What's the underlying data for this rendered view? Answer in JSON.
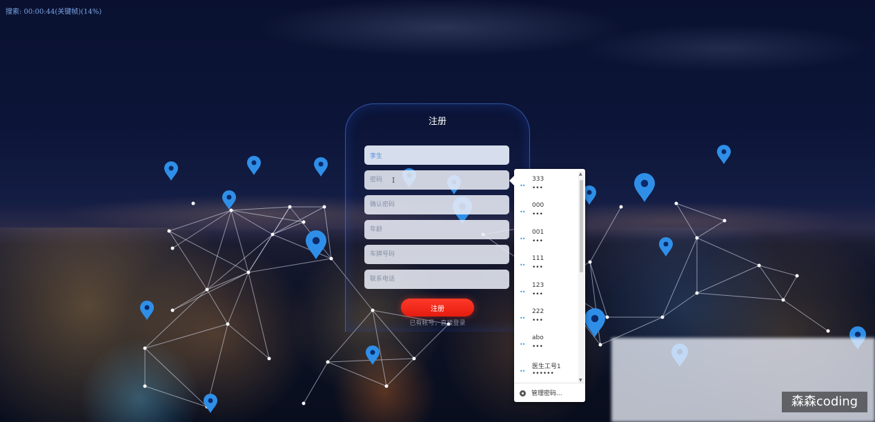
{
  "status_text": "搜索: 00:00:44(关键帧)(14%)",
  "register": {
    "title": "注册",
    "fields": [
      {
        "name": "username-field",
        "value": "李生",
        "placeholder": ""
      },
      {
        "name": "password-field",
        "value": "",
        "placeholder": "密码"
      },
      {
        "name": "confirm-password-field",
        "value": "",
        "placeholder": "确认密码"
      },
      {
        "name": "age-field",
        "value": "",
        "placeholder": "年龄"
      },
      {
        "name": "plate-number-field",
        "value": "",
        "placeholder": "车牌号码"
      },
      {
        "name": "phone-field",
        "value": "",
        "placeholder": "联系电话"
      }
    ],
    "submit_label": "注册",
    "login_prompt": "已有帐号，直接登录"
  },
  "password_dropdown": {
    "items": [
      {
        "user": "333",
        "pass": "•••"
      },
      {
        "user": "000",
        "pass": "•••"
      },
      {
        "user": "001",
        "pass": "•••"
      },
      {
        "user": "111",
        "pass": "•••"
      },
      {
        "user": "123",
        "pass": "•••"
      },
      {
        "user": "222",
        "pass": "•••"
      },
      {
        "user": "abo",
        "pass": "•••"
      },
      {
        "user": "医生工号1",
        "pass": "••••••"
      }
    ],
    "key_glyph": "••",
    "manage_label": "管理密码..."
  },
  "watermark": "森森coding",
  "colors": {
    "accent_red": "#e41c10",
    "pin_blue": "#2f8fe8",
    "card_border": "#508cff"
  }
}
